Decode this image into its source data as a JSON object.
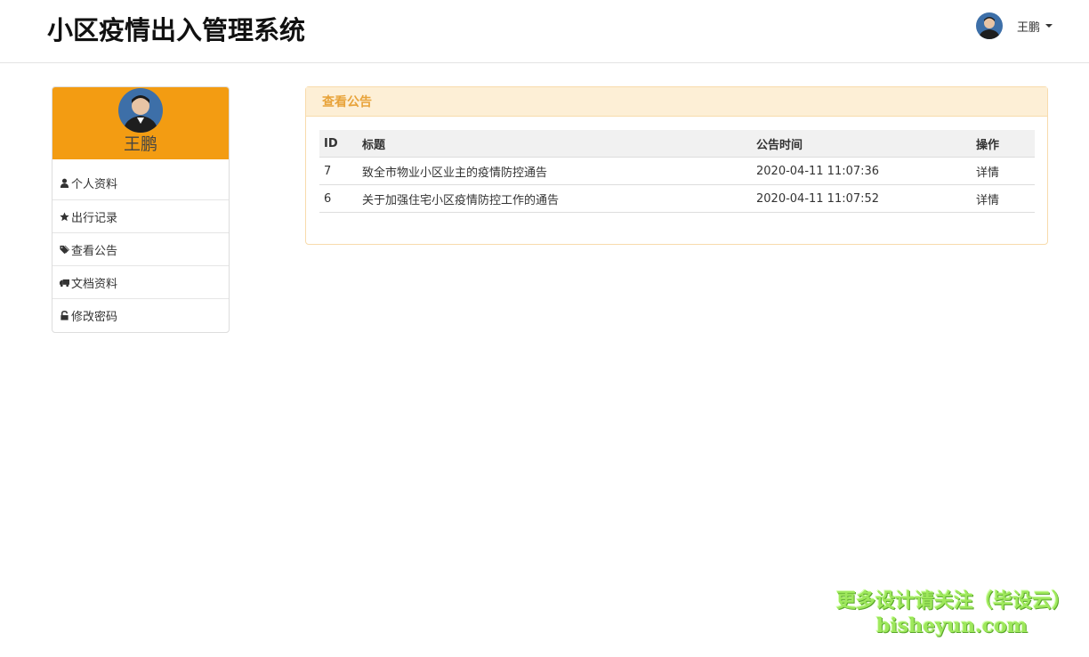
{
  "header": {
    "title": "小区疫情出入管理系统",
    "user_name": "王鹏"
  },
  "sidebar": {
    "user_name": "王鹏",
    "accent_color": "#f39c12",
    "items": [
      {
        "label": "个人资料",
        "icon": "user-icon"
      },
      {
        "label": "出行记录",
        "icon": "star-icon"
      },
      {
        "label": "查看公告",
        "icon": "tags-icon"
      },
      {
        "label": "文档资料",
        "icon": "truck-icon"
      },
      {
        "label": "修改密码",
        "icon": "lock-icon"
      }
    ]
  },
  "main": {
    "panel_title": "查看公告",
    "table": {
      "headers": {
        "id": "ID",
        "title": "标题",
        "time": "公告时间",
        "op": "操作"
      },
      "rows": [
        {
          "id": "7",
          "title": "致全市物业小区业主的疫情防控通告",
          "time": "2020-04-11 11:07:36",
          "op": "详情"
        },
        {
          "id": "6",
          "title": "关于加强住宅小区疫情防控工作的通告",
          "time": "2020-04-11 11:07:52",
          "op": "详情"
        }
      ]
    }
  },
  "watermark": {
    "line1": "更多设计请关注（毕设云）",
    "line2": "bisheyun.com"
  }
}
